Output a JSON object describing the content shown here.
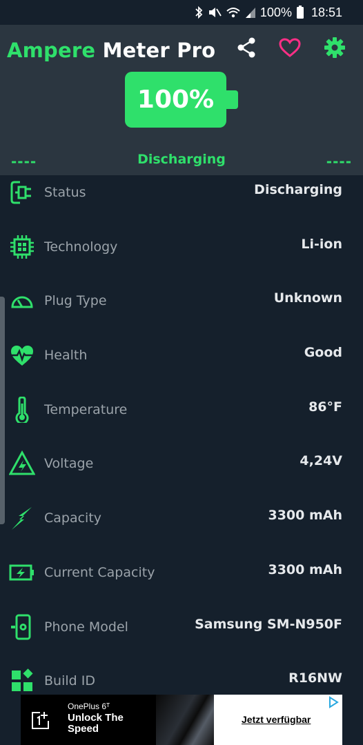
{
  "status_bar": {
    "battery_text": "100%",
    "time": "18:51",
    "icons": [
      "bluetooth-icon",
      "mute-icon",
      "wifi-icon",
      "signal-icon",
      "battery-icon"
    ]
  },
  "header": {
    "title_accent": "Ampere",
    "title_rest": "Meter Pro",
    "battery_percent": "100%",
    "left_dash": "----",
    "right_dash": "----",
    "status": "Discharging",
    "actions": [
      "share-icon",
      "heart-icon",
      "gear-icon"
    ]
  },
  "rows": [
    {
      "label": "Status",
      "value": "Discharging",
      "icon": "plug-icon"
    },
    {
      "label": "Technology",
      "value": "Li-ion",
      "icon": "chip-icon"
    },
    {
      "label": "Plug Type",
      "value": "Unknown",
      "icon": "gauge-icon"
    },
    {
      "label": "Health",
      "value": "Good",
      "icon": "heart-pulse-icon"
    },
    {
      "label": "Temperature",
      "value": "86°F",
      "icon": "thermometer-icon"
    },
    {
      "label": "Voltage",
      "value": "4,24V",
      "icon": "voltage-warning-icon"
    },
    {
      "label": "Capacity",
      "value": "3300 mAh",
      "icon": "lightning-icon"
    },
    {
      "label": "Current Capacity",
      "value": "3300 mAh",
      "icon": "battery-charge-icon"
    },
    {
      "label": "Phone Model",
      "value": "Samsung SM-N950F",
      "icon": "phone-settings-icon"
    },
    {
      "label": "Build ID",
      "value": "R16NW",
      "icon": "widgets-icon"
    }
  ],
  "ad": {
    "brand": "OnePlus 6ᵀ",
    "tagline": "Unlock The Speed",
    "cta": "Jetzt verfügbar"
  },
  "colors": {
    "accent": "#2fe06b",
    "heart": "#ff2f86",
    "background": "#15202c",
    "header": "#2b3640"
  }
}
